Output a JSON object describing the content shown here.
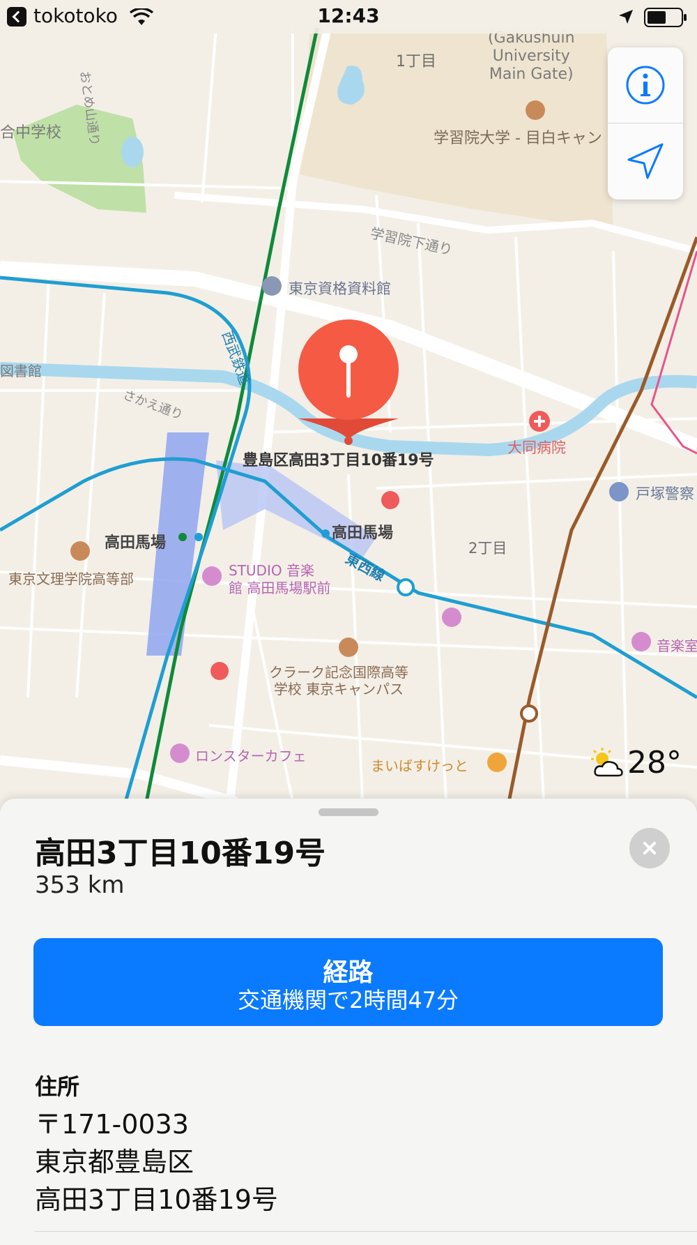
{
  "status_bar": {
    "app_name": "tokotoko",
    "time": "12:43"
  },
  "map": {
    "labels": {
      "chome1": "1丁目",
      "gakushuin_en": "(Gakushuin\nUniversity\nMain Gate)",
      "gakushuin_ja": "学習院大学 - 目白キャン",
      "otomeyama": "おとめ山通り",
      "school_left": "合中学校",
      "gakushuin_st": "学習院下通り",
      "shikaku": "東京資格資料館",
      "seibu": "西武鉄道",
      "library": "図書館",
      "sakae": "さかえ通り",
      "pin_label": "豊島区高田3丁目10番19号",
      "hospital": "大同病院",
      "police": "戸塚警察",
      "station_west": "高田馬場",
      "station_east": "高田馬場",
      "chome2": "2丁目",
      "tozai": "東西線",
      "bunri": "東京文理学院高等部",
      "studio": "STUDIO 音楽\n館 高田馬場駅前",
      "ongaku": "音楽室",
      "clark": "クラーク記念国際高等\n学校 東京キャンパス",
      "lonestar": "ロンスターカフェ",
      "maiba": "まいばすけっと"
    },
    "info_button_icon": "info-icon",
    "location_button_icon": "location-arrow-icon",
    "weather": {
      "icon": "partly-cloudy-icon",
      "temperature": "28°"
    },
    "colors": {
      "pin": "#f55a45",
      "tozai": "#1f9ed1",
      "seibu": "#0f8a3a",
      "fukutoshin": "#9a5a2a",
      "water": "#a9d8ee"
    }
  },
  "place_card": {
    "title": "高田3丁目10番19号",
    "distance": "353 km",
    "route_button": {
      "label": "経路",
      "sub": "交通機関で2時間47分"
    },
    "address": {
      "heading": "住所",
      "postal": "〒171-0033",
      "city": "東京都豊島区",
      "street": "高田3丁目10番19号"
    },
    "accent": "#0a7aff"
  }
}
